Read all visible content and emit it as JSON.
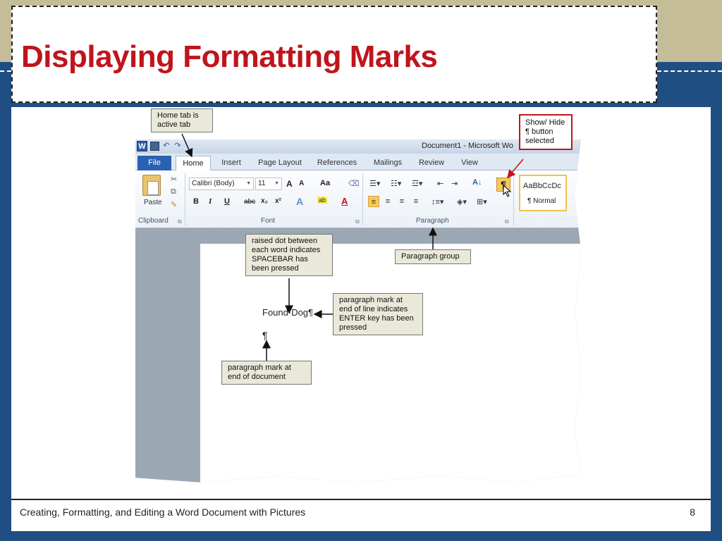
{
  "slide": {
    "title": "Displaying Formatting Marks",
    "footer": "Creating, Formatting, and Editing a Word Document with Pictures",
    "page_number": "8"
  },
  "word": {
    "window_title": "Document1 - Microsoft Wo",
    "tabs": [
      "File",
      "Home",
      "Insert",
      "Page Layout",
      "References",
      "Mailings",
      "Review",
      "View"
    ],
    "active_tab": "Home",
    "clipboard": {
      "paste_label": "Paste",
      "group_label": "Clipboard"
    },
    "font": {
      "name": "Calibri (Body)",
      "size": "11",
      "group_label": "Font",
      "aa_label": "Aa",
      "grow": "A",
      "shrink": "A"
    },
    "paragraph": {
      "group_label": "Paragraph",
      "pilcrow": "¶"
    },
    "styles": {
      "sample": "AaBbCcDc",
      "name": "¶ Normal"
    },
    "document": {
      "line1": "Found·Dog¶",
      "line2": "¶"
    }
  },
  "callouts": {
    "home_tab": "Home tab is active tab",
    "show_hide": "Show/ Hide ¶ button selected",
    "raised_dot": "raised dot between each word indicates SPACEBAR has been pressed",
    "paragraph_group": "Paragraph group",
    "para_mark_line": "paragraph mark at end of line indicates ENTER key has been pressed",
    "para_mark_doc": "paragraph mark at end of document"
  },
  "icons": [
    "word-logo-icon",
    "save-icon",
    "undo-icon",
    "redo-icon",
    "paste-icon",
    "cut-icon",
    "copy-icon",
    "format-painter-icon",
    "bullets-icon",
    "numbering-icon",
    "multilevel-list-icon",
    "decrease-indent-icon",
    "increase-indent-icon",
    "sort-icon",
    "pilcrow-icon",
    "cursor-icon",
    "spelling-icon",
    "shading-icon",
    "borders-icon"
  ],
  "colors": {
    "title": "#c0141c",
    "background": "#1f4e82",
    "tan": "#c4bd97",
    "callout": "#eae8d9",
    "highlight_button": "#f7c85e"
  }
}
